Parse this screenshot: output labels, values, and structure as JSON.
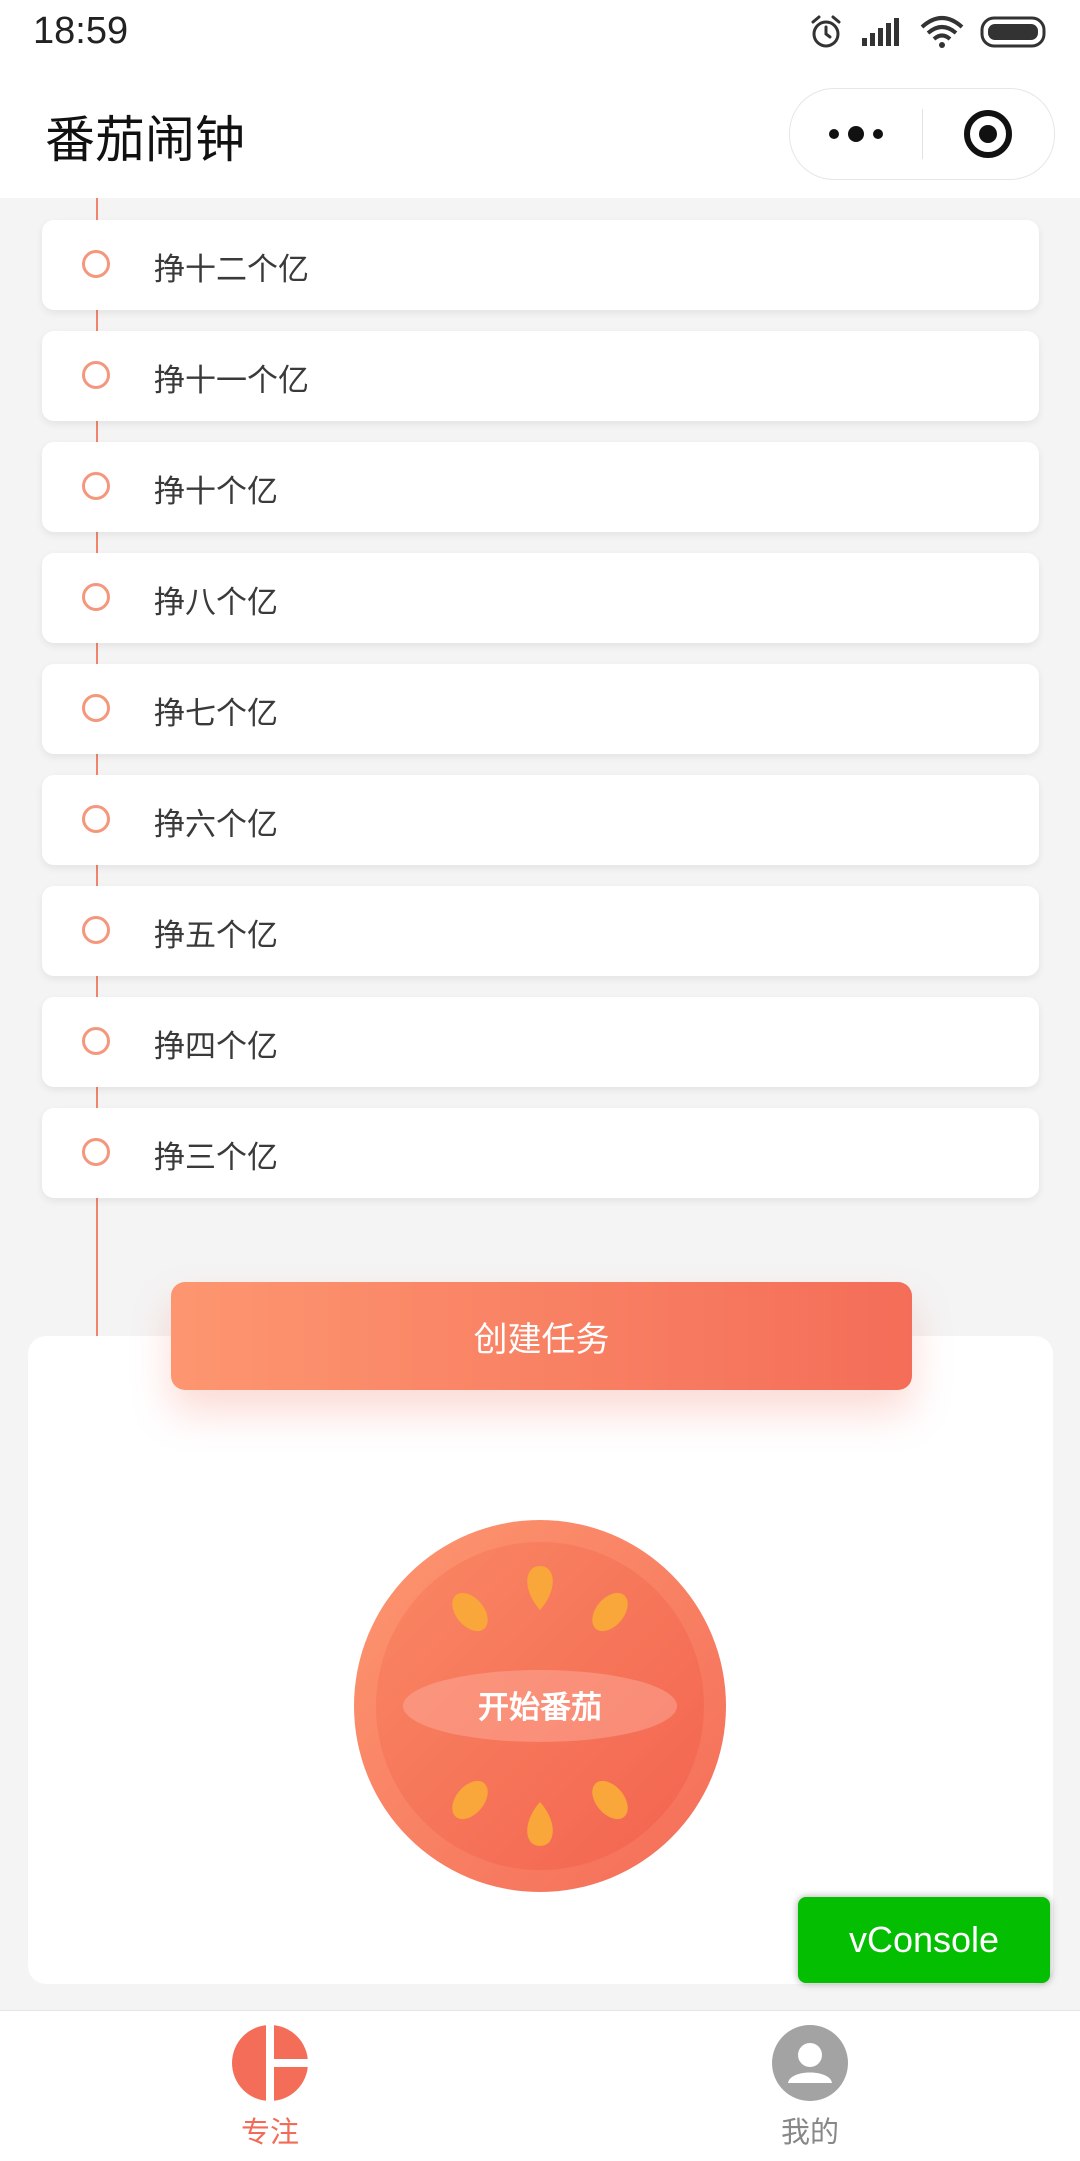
{
  "status_bar": {
    "time": "18:59"
  },
  "nav": {
    "title": "番茄闹钟"
  },
  "tasks": [
    {
      "label": "挣十二个亿"
    },
    {
      "label": "挣十一个亿"
    },
    {
      "label": "挣十个亿"
    },
    {
      "label": "挣八个亿"
    },
    {
      "label": "挣七个亿"
    },
    {
      "label": "挣六个亿"
    },
    {
      "label": "挣五个亿"
    },
    {
      "label": "挣四个亿"
    },
    {
      "label": "挣三个亿"
    }
  ],
  "create_button": {
    "label": "创建任务"
  },
  "tomato": {
    "label": "开始番茄"
  },
  "vconsole": {
    "label": "vConsole"
  },
  "tabbar": {
    "items": [
      {
        "label": "专注",
        "icon": "tomato-tab-icon",
        "active": true
      },
      {
        "label": "我的",
        "icon": "user-avatar-icon",
        "active": false
      }
    ]
  },
  "colors": {
    "accent": "#f46d58",
    "accent_light": "#fd9670",
    "seed": "#f9a63a",
    "vconsole": "#04be02"
  }
}
